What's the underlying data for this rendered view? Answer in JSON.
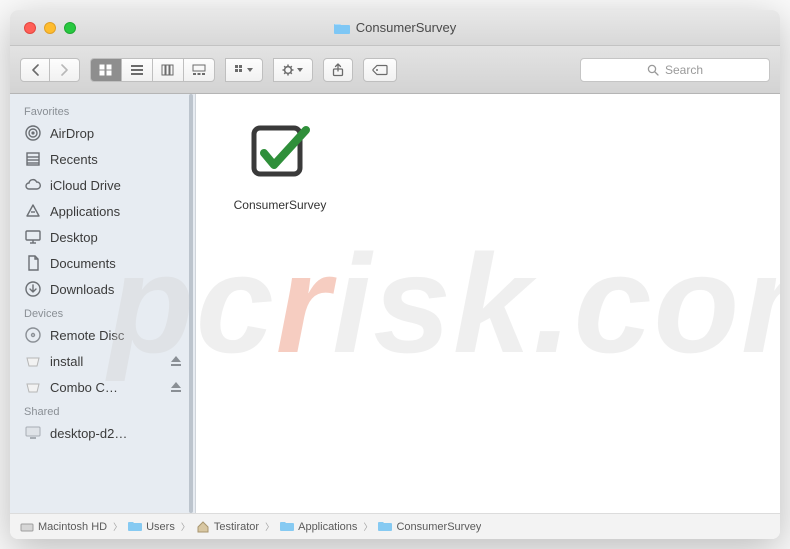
{
  "window": {
    "title": "ConsumerSurvey"
  },
  "toolbar": {
    "search_placeholder": "Search"
  },
  "sidebar": {
    "sections": {
      "favorites": {
        "header": "Favorites",
        "items": [
          "AirDrop",
          "Recents",
          "iCloud Drive",
          "Applications",
          "Desktop",
          "Documents",
          "Downloads"
        ]
      },
      "devices": {
        "header": "Devices",
        "items": [
          "Remote Disc",
          "install",
          "Combo C…"
        ]
      },
      "shared": {
        "header": "Shared",
        "items": [
          "desktop-d2…"
        ]
      }
    }
  },
  "content": {
    "files": [
      {
        "name": "ConsumerSurvey"
      }
    ]
  },
  "pathbar": {
    "crumbs": [
      "Macintosh HD",
      "Users",
      "Testirator",
      "Applications",
      "ConsumerSurvey"
    ]
  },
  "watermark": {
    "pc": "pc",
    "r": "r",
    "rest": "isk.com"
  }
}
